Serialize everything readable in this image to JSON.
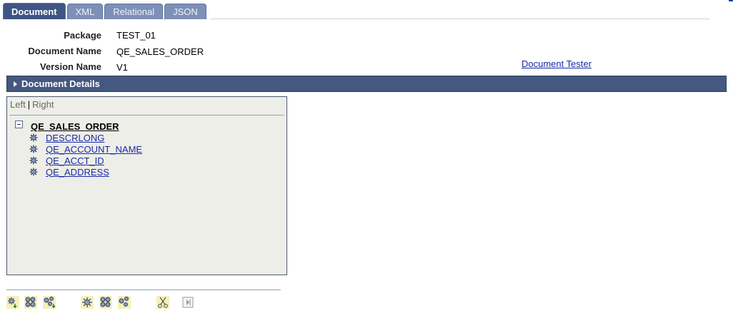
{
  "tabs": [
    {
      "label": "Document",
      "active": true
    },
    {
      "label": "XML",
      "active": false
    },
    {
      "label": "Relational",
      "active": false
    },
    {
      "label": "JSON",
      "active": false
    }
  ],
  "header": {
    "package_label": "Package",
    "package_value": "TEST_01",
    "document_name_label": "Document Name",
    "document_name_value": "QE_SALES_ORDER",
    "version_name_label": "Version Name",
    "version_name_value": "V1",
    "document_tester_link": "Document Tester"
  },
  "section": {
    "title": "Document Details",
    "expanded": false
  },
  "tree": {
    "view_left": "Left",
    "view_separator": "|",
    "view_right": "Right",
    "root": "QE_SALES_ORDER",
    "children": [
      "DESCRLONG",
      "QE_ACCOUNT_NAME",
      "QE_ACCT_ID",
      "QE_ADDRESS"
    ]
  },
  "toolbar": {
    "buttons": [
      {
        "icon": "add-child-element-icon"
      },
      {
        "icon": "add-collection-icon"
      },
      {
        "icon": "add-compound-icon"
      },
      {
        "icon": "insert-element-icon"
      },
      {
        "icon": "insert-collection-icon"
      },
      {
        "icon": "insert-compound-icon"
      },
      {
        "icon": "cut-icon"
      },
      {
        "icon": "paste-icon"
      }
    ]
  },
  "colors": {
    "tab_active": "#3e5585",
    "tab_inactive": "#7d91b8",
    "section_bar": "#45587f",
    "link": "#1a2aa6",
    "tree_panel_bg": "#eeeee8"
  }
}
